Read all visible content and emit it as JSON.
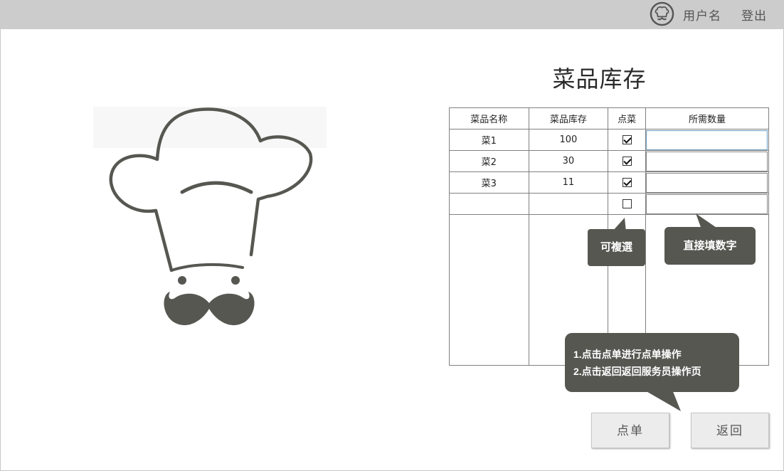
{
  "header": {
    "username": "用户名",
    "logout_label": "登出",
    "avatar_icon": "chef-avatar-icon"
  },
  "hero": {
    "icon": "chef-hat-mustache-icon",
    "color": "#575752"
  },
  "page": {
    "title": "菜品库存"
  },
  "table": {
    "columns": [
      "菜品名称",
      "菜品库存",
      "点菜",
      "所需数量"
    ],
    "rows": [
      {
        "name": "菜1",
        "stock": "100",
        "checked": true,
        "quantity": ""
      },
      {
        "name": "菜2",
        "stock": "30",
        "checked": true,
        "quantity": ""
      },
      {
        "name": "菜3",
        "stock": "11",
        "checked": true,
        "quantity": ""
      },
      {
        "name": "",
        "stock": "",
        "checked": false,
        "quantity": ""
      }
    ]
  },
  "tooltips": {
    "multi_select": "可複選",
    "enter_number": "直接填数字",
    "instructions_line1": "1.点击点单进行点单操作",
    "instructions_line2": "2.点击返回返回服务员操作页"
  },
  "buttons": {
    "order_label": "点单",
    "back_label": "返回"
  },
  "colors": {
    "topbar": "#cccccc",
    "bubble": "#575752",
    "button_bg": "#ececec"
  }
}
